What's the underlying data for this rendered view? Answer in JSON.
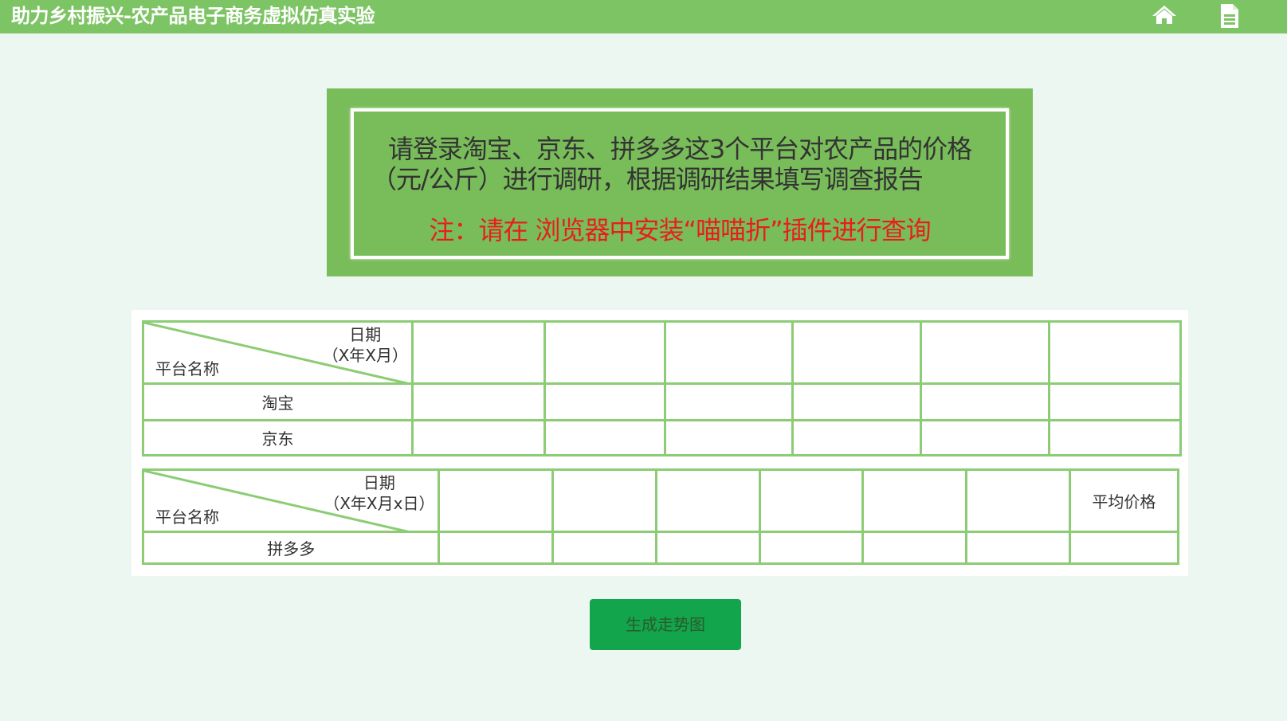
{
  "app": {
    "title": "助力乡村振兴-农产品电子商务虚拟仿真实验",
    "icons": [
      "home-icon",
      "document-icon"
    ],
    "bar_color": "#7dc465"
  },
  "notice": {
    "line1": "请登录淘宝、京东、拼多多这3个平台对农产品的价格",
    "line2": "（元/公斤）进行调研，根据调研结果填写调查报告",
    "line3": "注：请在 浏览器中安装“喵喵折”插件进行查询",
    "warning_color": "#e81e1e"
  },
  "table1": {
    "header_top": "日期",
    "header_top2": "（X年X月）",
    "header_bottom": "平台名称",
    "rows": [
      "淘宝",
      "京东"
    ]
  },
  "table2": {
    "header_top": "日期",
    "header_top2": "（X年X月x日）",
    "header_bottom": "平台名称",
    "last_col": "平均价格",
    "rows": [
      "拼多多"
    ]
  },
  "button": {
    "label": "生成走势图"
  }
}
